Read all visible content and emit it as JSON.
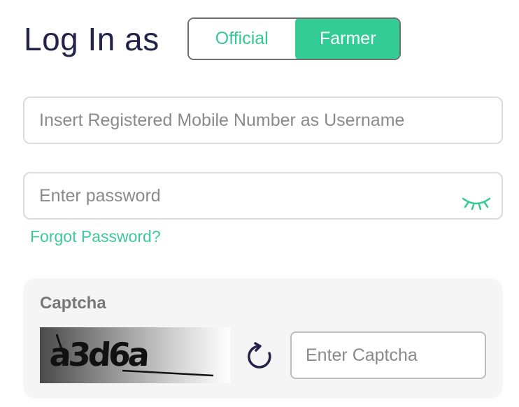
{
  "header": {
    "title": "Log In as"
  },
  "role_toggle": {
    "options": [
      {
        "label": "Official",
        "active": false
      },
      {
        "label": "Farmer",
        "active": true
      }
    ],
    "accent_color": "#32cc94"
  },
  "username": {
    "placeholder": "Insert Registered Mobile Number as Username",
    "value": ""
  },
  "password": {
    "placeholder": "Enter password",
    "value": "",
    "toggle_icon": "eye-closed-icon"
  },
  "forgot_password": {
    "label": "Forgot Password?"
  },
  "captcha": {
    "label": "Captcha",
    "image_text": "a3d6a",
    "refresh_icon": "refresh-icon",
    "input_placeholder": "Enter Captcha",
    "input_value": ""
  }
}
